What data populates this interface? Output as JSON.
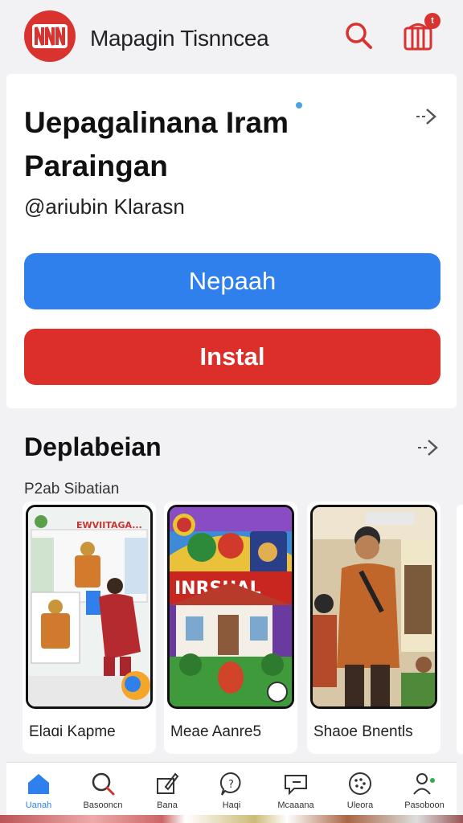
{
  "header": {
    "app_title": "Mapagin Tisnncea",
    "notification_count": "t",
    "accent": "#d9332f"
  },
  "app_card": {
    "title_line1": "Uepagalinana Iram",
    "title_line2": "Paraingan",
    "handle": "@ariubin Klarasn",
    "primary_button": "Nepaah",
    "install_button": "Instal",
    "primary_color": "#2f80ed",
    "install_color": "#dc2f2a"
  },
  "section": {
    "title": "Deplabeian",
    "subtitle": "P2ab Sibatian",
    "tiles": [
      {
        "label": "Elaɑi Kapme",
        "banner": "EWVIITAGA..."
      },
      {
        "label": "Meae Aanre5",
        "banner": "INRSUAL"
      },
      {
        "label": "Shaoe Bnentls"
      }
    ]
  },
  "nav": {
    "items": [
      {
        "label": "Uanah",
        "icon": "home-icon",
        "active": true
      },
      {
        "label": "Basooncn",
        "icon": "search-icon"
      },
      {
        "label": "Bana",
        "icon": "edit-icon"
      },
      {
        "label": "Haqi",
        "icon": "help-icon"
      },
      {
        "label": "Mcaaana",
        "icon": "message-icon"
      },
      {
        "label": "Uleora",
        "icon": "grid-icon"
      },
      {
        "label": "Pasoboon",
        "icon": "profile-icon"
      }
    ]
  }
}
